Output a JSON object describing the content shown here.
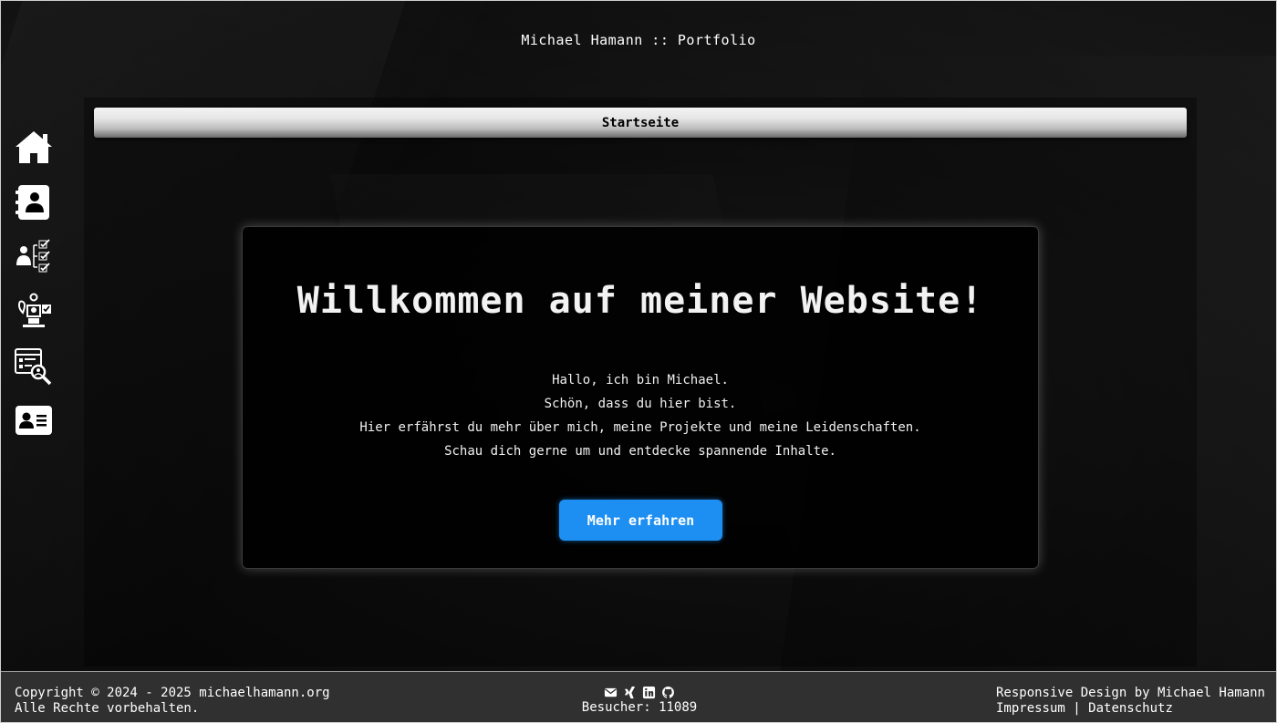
{
  "header": {
    "site_title": "Michael Hamann :: Portfolio"
  },
  "breadcrumb": {
    "label": "Startseite"
  },
  "sidebar": {
    "items": [
      {
        "icon": "home-icon"
      },
      {
        "icon": "contact-book-icon"
      },
      {
        "icon": "person-checklist-icon"
      },
      {
        "icon": "projects-icon"
      },
      {
        "icon": "web-search-icon"
      },
      {
        "icon": "id-card-icon"
      }
    ]
  },
  "main": {
    "heading": "Willkommen auf meiner Website!",
    "lines": [
      "Hallo, ich bin Michael.",
      "Schön, dass du hier bist.",
      "Hier erfährst du mehr über mich, meine Projekte und meine Leidenschaften.",
      "Schau dich gerne um und entdecke spannende Inhalte."
    ],
    "cta_label": "Mehr erfahren"
  },
  "footer": {
    "copyright": "Copyright © 2024 - 2025 michaelhamann.org",
    "rights": "Alle Rechte vorbehalten.",
    "social_icons": [
      "mail-icon",
      "xing-icon",
      "linkedin-icon",
      "github-icon"
    ],
    "visitors": "Besucher: 11089",
    "design_credit": "Responsive Design by Michael Hamann",
    "imprint": "Impressum",
    "separator": "|",
    "privacy": "Datenschutz"
  },
  "colors": {
    "accent": "#1e8ff2",
    "background": "#0a0a0a",
    "footer_bg": "#303030"
  }
}
